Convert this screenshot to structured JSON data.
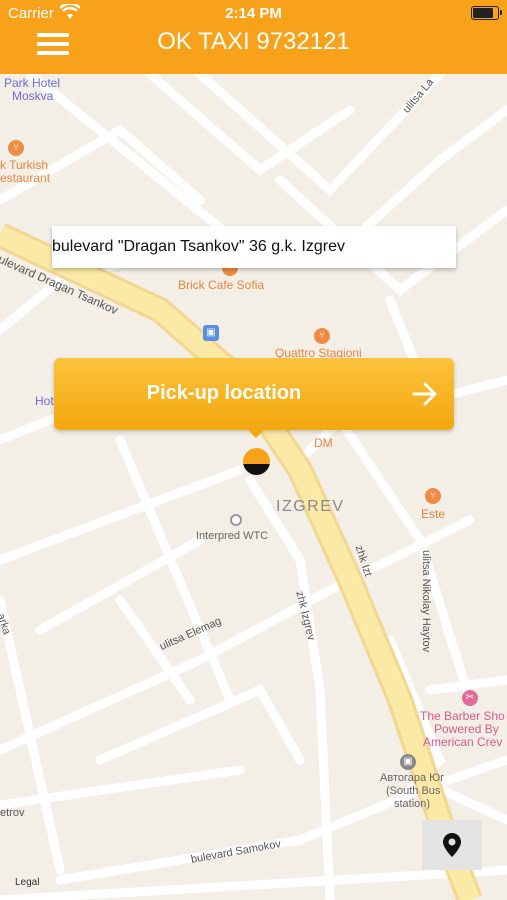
{
  "status_bar": {
    "carrier": "Carrier",
    "time": "2:14 PM",
    "battery_level": 0.85
  },
  "app_bar": {
    "title": "OK TAXI 9732121"
  },
  "address": {
    "text": "bulevard \"Dragan Tsankov\" 36 g.k. Izgrev"
  },
  "pickup": {
    "label": "Pick-up location"
  },
  "map": {
    "poi_park_hotel_1": "Park Hotel",
    "poi_park_hotel_2": "Moskva",
    "poi_turkish_1": "k Turkish",
    "poi_turkish_2": "estaurant",
    "poi_brick_cafe": "Brick Cafe Sofia",
    "poi_quattro": "Quattro Stagioni",
    "poi_hotel": "Hot",
    "poi_dm": "DM",
    "poi_este": "Este",
    "poi_barber_1": "The Barber Sho",
    "poi_barber_2": "Powered By",
    "poi_barber_3": "American Crev",
    "poi_interpred": "Interpred WTC",
    "poi_avtogara_1": "Автогара Юг",
    "poi_avtogara_2": "(South Bus",
    "poi_avtogara_3": "station)",
    "district": "IZGREV",
    "street_dragan": "ulevard Dragan Tsankov",
    "street_elemag": "ulitsa Elemag",
    "street_samokov": "bulevard Samokov",
    "street_zhk": "zhk Izgrev",
    "street_haytov": "ulitsa Nikolay Haytov",
    "street_laz": "ulitsa La",
    "street_zhk2": "zhk Izt",
    "street_petrov": "etrov",
    "street_arka": "arka",
    "legal": "Legal"
  },
  "colors": {
    "brand": "#f7a21a",
    "button": "#f4a70f",
    "map_bg": "#f3efe7",
    "major_road": "#fbe9a6"
  }
}
